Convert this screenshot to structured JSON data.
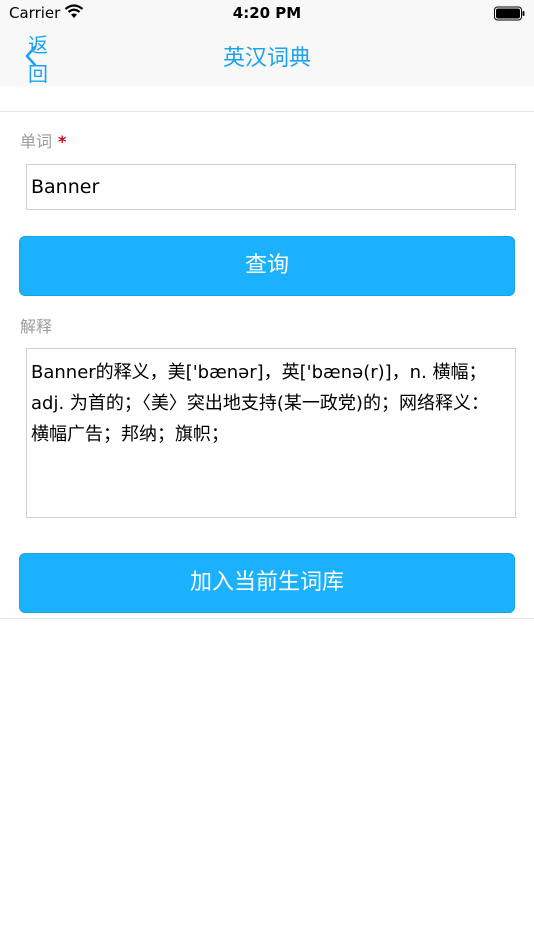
{
  "status_bar": {
    "carrier": "Carrier",
    "time": "4:20 PM"
  },
  "nav": {
    "back_label": "返回",
    "title": "英汉词典"
  },
  "form": {
    "word_label": "单词",
    "required_mark": "*",
    "word_value": "Banner",
    "query_button": "查询",
    "explain_label": "解释",
    "explanation": "Banner的释义，美['bænər]，英['bænə(r)]，n. 横幅； adj. 为首的；〈美〉突出地支持(某一政党)的；网络释义： 横幅广告；邦纳；旗帜；",
    "add_button": "加入当前生词库"
  },
  "colors": {
    "accent": "#1aa3f0",
    "button": "#1cb1ff",
    "required": "#d0021b"
  }
}
